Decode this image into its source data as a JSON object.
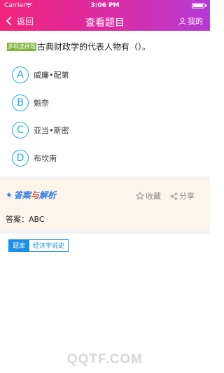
{
  "status_bar": {
    "carrier": "Carrier",
    "time": "3:06 PM"
  },
  "nav": {
    "back_label": "返回",
    "title": "查看题目",
    "mine_label": "我的"
  },
  "question": {
    "tag": "多项选择题",
    "text": "古典财政学的代表人物有（）。",
    "options": [
      {
        "letter": "A",
        "text": "威廉•配第"
      },
      {
        "letter": "B",
        "text": "魁奈"
      },
      {
        "letter": "C",
        "text": "亚当•斯密"
      },
      {
        "letter": "D",
        "text": "布坎南"
      }
    ]
  },
  "answer": {
    "logo_star": "★",
    "logo_part1": "答案",
    "logo_part2": "与",
    "logo_part3": "解析",
    "favorite_label": "收藏",
    "share_label": "分享",
    "answer_text": "答案：ABC"
  },
  "breadcrumbs": [
    "题库",
    "经济学说史"
  ],
  "watermark": "QQTF.COM",
  "colors": {
    "header_start": "#f2257c",
    "header_end": "#b53ad6",
    "option_accent": "#1eaee4",
    "tag_green": "#7fb63a",
    "answer_bg": "#fdf4ea",
    "crumb_blue": "#1e90e6"
  },
  "icons": {
    "back": "chevron-left-icon",
    "mine": "user-icon",
    "favorite": "star-outline-icon",
    "share": "share-icon"
  }
}
